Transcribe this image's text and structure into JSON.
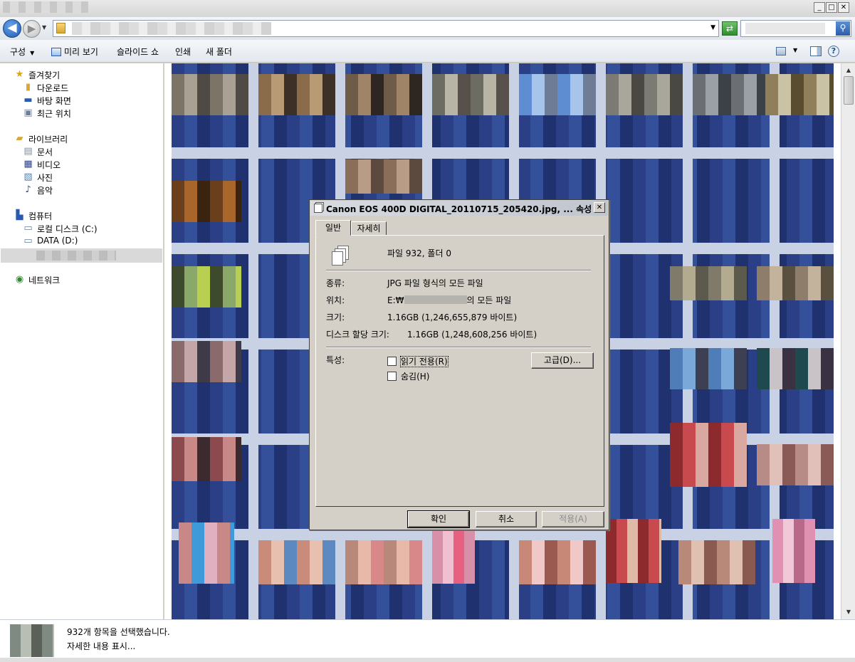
{
  "window": {
    "minimize_glyph": "_",
    "maximize_glyph": "□",
    "close_glyph": "✕"
  },
  "nav": {
    "back_glyph": "◀",
    "forward_glyph": "▶"
  },
  "toolbar": {
    "organize_label": "구성",
    "preview_label": "미리 보기",
    "slideshow_label": "슬라이드 쇼",
    "print_label": "인쇄",
    "new_folder_label": "새 폴더"
  },
  "sidebar": {
    "favorites": {
      "label": "즐겨찾기",
      "items": [
        {
          "label": "다운로드",
          "icon": "download-folder-icon"
        },
        {
          "label": "바탕 화면",
          "icon": "desktop-icon"
        },
        {
          "label": "최근 위치",
          "icon": "recent-places-icon"
        }
      ]
    },
    "libraries": {
      "label": "라이브러리",
      "items": [
        {
          "label": "문서",
          "icon": "documents-icon"
        },
        {
          "label": "비디오",
          "icon": "videos-icon"
        },
        {
          "label": "사진",
          "icon": "pictures-icon"
        },
        {
          "label": "음악",
          "icon": "music-icon"
        }
      ]
    },
    "computer": {
      "label": "컴퓨터",
      "items": [
        {
          "label": "로컬 디스크 (C:)",
          "icon": "local-disk-icon"
        },
        {
          "label": "DATA (D:)",
          "icon": "drive-icon"
        }
      ]
    },
    "network": {
      "label": "네트워크",
      "icon": "network-icon"
    }
  },
  "dialog": {
    "title": "Canon EOS 400D DIGITAL_20110715_205420.jpg, ... 속성",
    "close_glyph": "✕",
    "tabs": [
      {
        "label": "일반",
        "selected": true
      },
      {
        "label": "자세히",
        "selected": false
      }
    ],
    "summary": "파일 932, 폴더 0",
    "type_label": "종류:",
    "type_value": "JPG 파일 형식의 모든 파일",
    "location_label": "위치:",
    "location_prefix": "E:₩",
    "location_suffix": "의 모든 파일",
    "size_label": "크기:",
    "size_value": "1.16GB (1,246,655,879 바이트)",
    "disk_size_label": "디스크 할당 크기:",
    "disk_size_value": "1.16GB (1,248,608,256 바이트)",
    "attributes_label": "특성:",
    "readonly_label": "읽기 전용(R)",
    "readonly_checked": false,
    "hidden_label": "숨김(H)",
    "hidden_checked": false,
    "advanced_button": "고급(D)...",
    "ok_button": "확인",
    "cancel_button": "취소",
    "apply_button": "적용(A)"
  },
  "status": {
    "selection_text": "932개 항목을 선택했습니다.",
    "details_link": "자세한 내용 표시..."
  },
  "colors": {
    "thumbnail_background": "#2a3f86",
    "selection_gray": "#d9d9d9",
    "dialog_face": "#d4d0c8"
  }
}
